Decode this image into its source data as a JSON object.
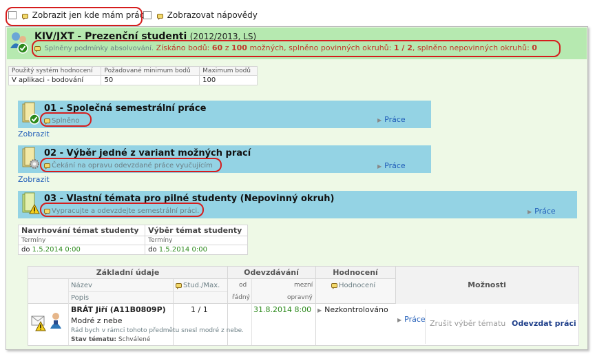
{
  "top": {
    "only_my_work": "Zobrazit jen kde mám práci",
    "show_help": "Zobrazovat nápovědy"
  },
  "course": {
    "title": "KIV/JXT - Prezenční studenti",
    "period": "(2012/2013, LS)",
    "status_prefix": "Splněny podmínky absolvování.",
    "points_text": "Získáno bodů:",
    "points_got": "60",
    "points_of": "z",
    "points_max": "100",
    "possible_text": "možných, splněno povinných okruhů:",
    "mandatory": "1 / 2",
    "optional_text": ", splněno nepovinných okruhů:",
    "optional": "0"
  },
  "rating_table": {
    "headers": [
      "Použitý systém hodnocení",
      "Požadované minimum bodů",
      "Maximum bodů"
    ],
    "values": [
      "V aplikaci - bodování",
      "50",
      "100"
    ]
  },
  "sections": [
    {
      "title": "01 - Společná semestrální práce",
      "status": "Splněno",
      "link": "Práce",
      "show": "Zobrazit"
    },
    {
      "title": "02 - Výběr jedné z variant možných prací",
      "status": "Čekání na opravu odevzdané práce vyučujícím",
      "link": "Práce",
      "show": "Zobrazit"
    },
    {
      "title": "03 - Vlastní témata pro pilné studenty (Nepovinný okruh)",
      "status": "Vypracujte a odevzdejte semestrální práci.",
      "link": "Práce"
    }
  ],
  "topics_table": {
    "col1": "Navrhování témat studenty",
    "col2": "Výběr témat studenty",
    "sub1": "Termíny",
    "sub2": "Termíny",
    "prefix1": "do",
    "date1": "1.5.2014 0:00",
    "prefix2": "do",
    "date2": "1.5.2014 0:00"
  },
  "work_table": {
    "h_basic": "Základní údaje",
    "h_submit": "Odevzdávání",
    "h_eval": "Hodnocení",
    "h_options": "Možnosti",
    "h_name": "Název",
    "h_popis": "Popis",
    "h_stud": "Stud./Max.",
    "h_from": "od",
    "h_regular": "řádný",
    "h_limit": "mezní",
    "h_fix": "opravný",
    "h_eval2": "Hodnocení",
    "row": {
      "name": "BRÁT Jiří (A11B0809P)",
      "subtitle": "Modré z nebe",
      "desc": "Rád bych v rámci tohoto předmětu snesl modré z nebe.",
      "state_label": "Stav tématu:",
      "state": "Schválené",
      "stud": "1 / 1",
      "date": "31.8.2014 8:00",
      "eval": "Nezkontrolováno",
      "work_link": "Práce",
      "cancel": "Zrušit výběr tématu",
      "submit": "Odevzdat práci"
    }
  },
  "colors": {
    "header_green": "#b6e9b0",
    "section_blue": "#94d3e4",
    "annotation_red": "#d51d1d"
  }
}
